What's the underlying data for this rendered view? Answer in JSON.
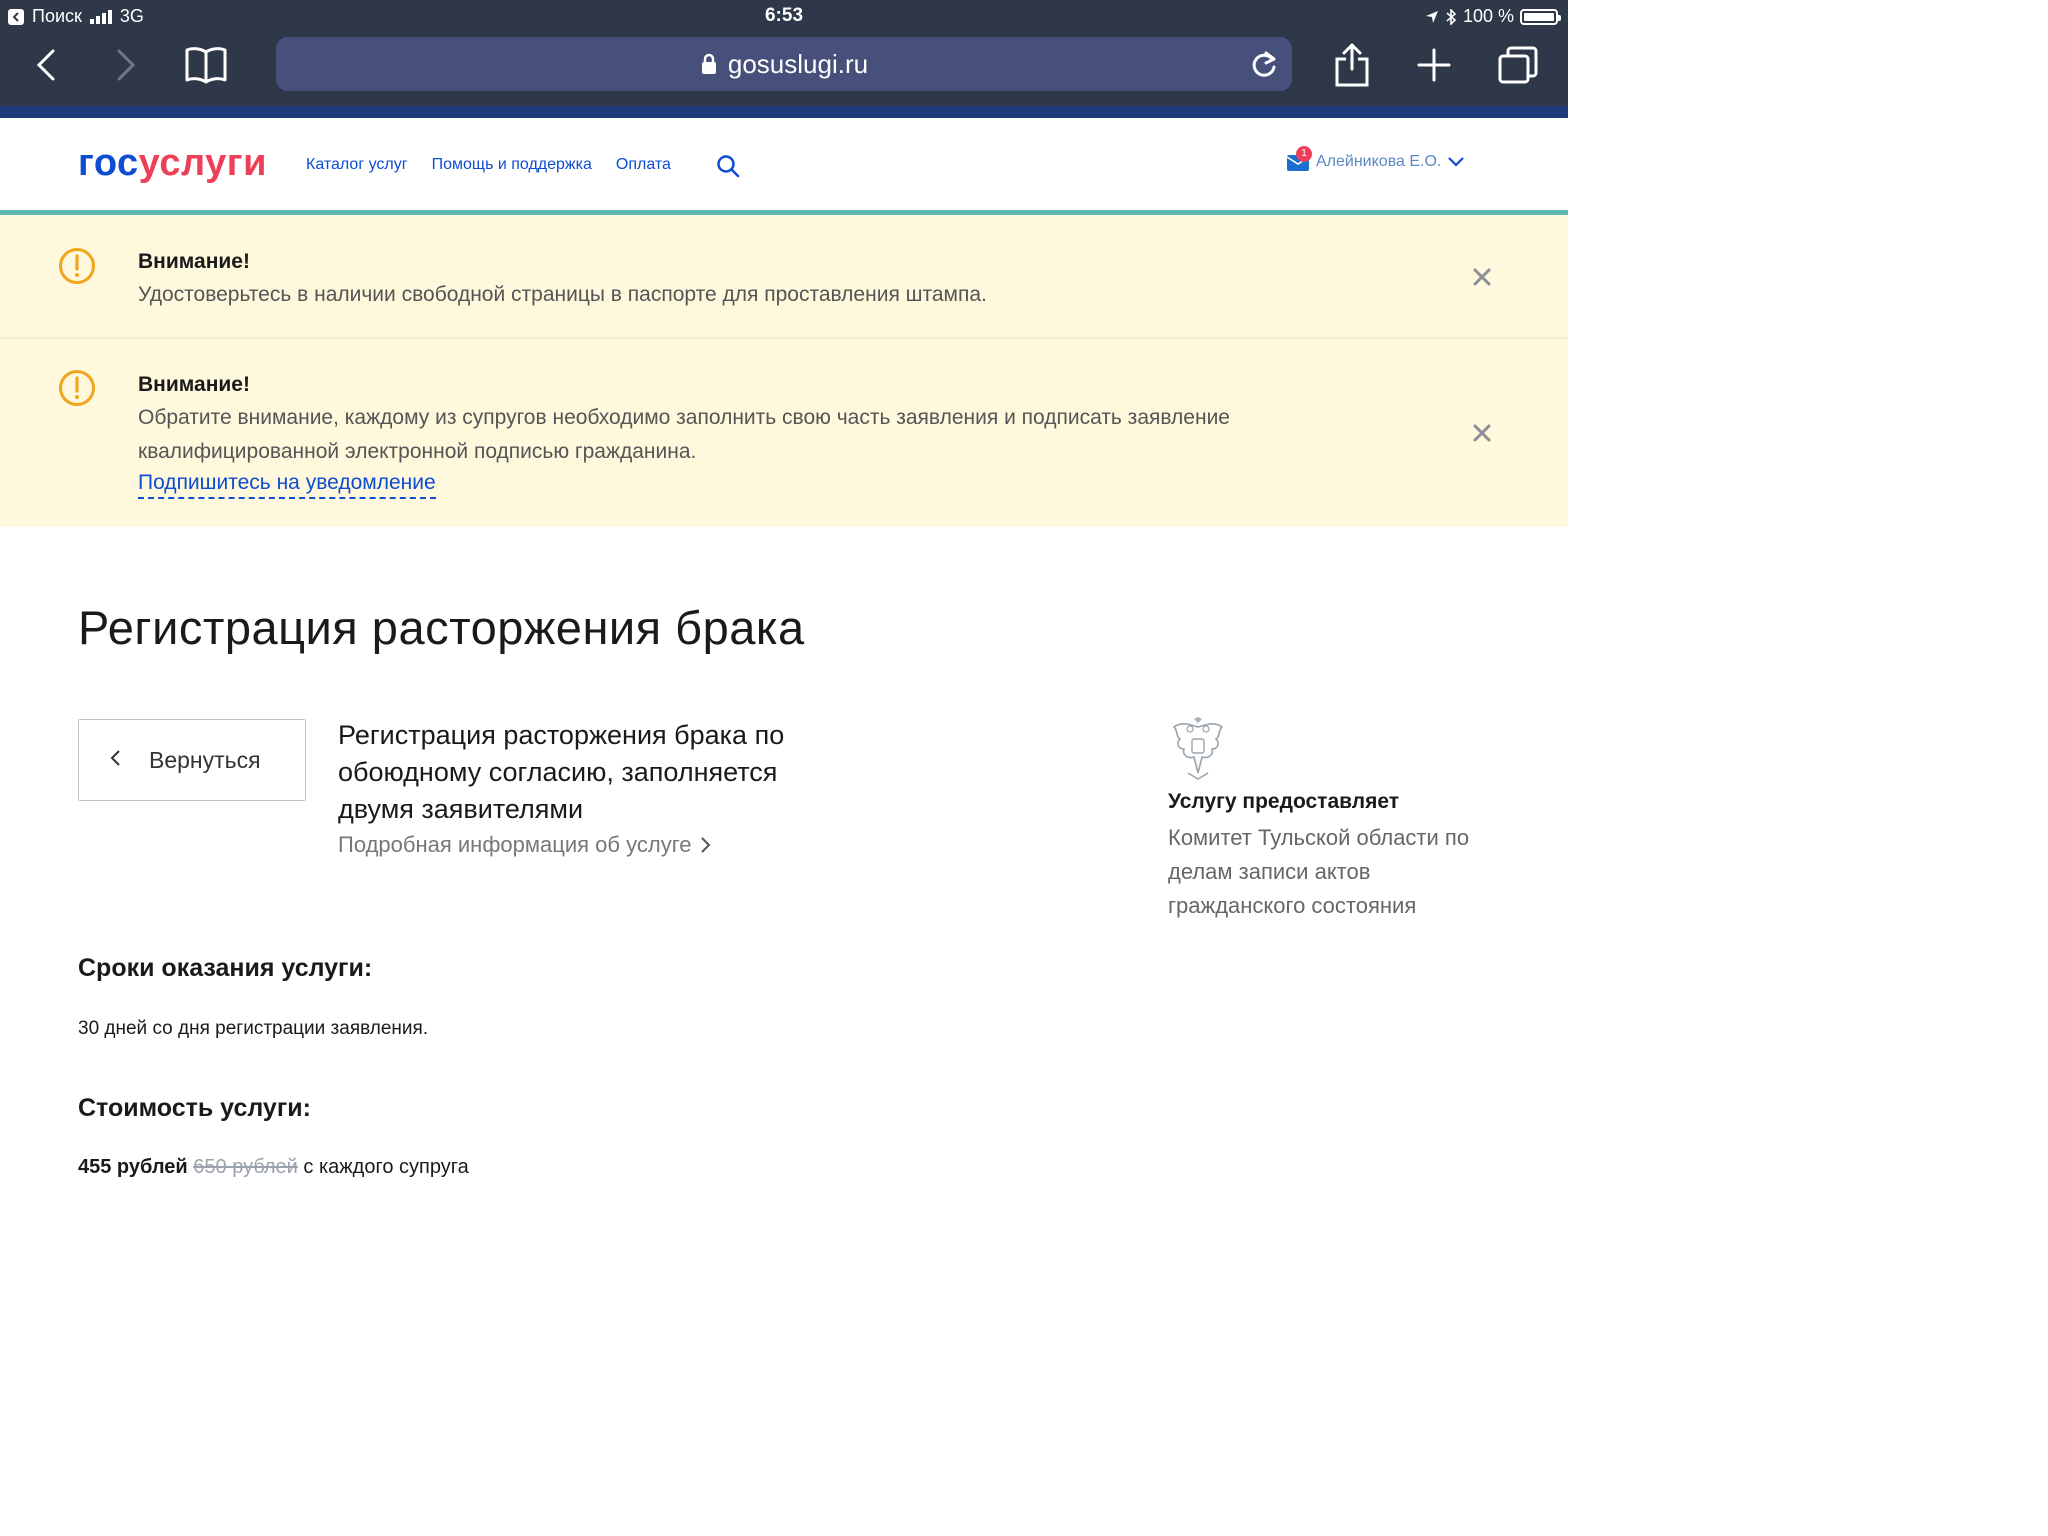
{
  "status_bar": {
    "back_app": "Поиск",
    "network": "3G",
    "time": "6:53",
    "battery": "100 %",
    "battery_level": 1.0
  },
  "browser": {
    "url": "gosuslugi.ru"
  },
  "header": {
    "logo_part1": "гос",
    "logo_part2": "услуги",
    "nav": [
      "Каталог услуг",
      "Помощь и поддержка",
      "Оплата"
    ],
    "notifications_count": "1",
    "user_name": "Алейникова Е.О."
  },
  "alerts": [
    {
      "title": "Внимание!",
      "text": "Удостоверьтесь в наличии свободной страницы в паспорте для проставления штампа."
    },
    {
      "title": "Внимание!",
      "text": "Обратите внимание, каждому из супругов необходимо заполнить свою часть заявления и подписать заявление квалифицированной электронной подписью гражданина.",
      "link": "Подпишитесь на уведомление"
    }
  ],
  "main": {
    "page_title": "Регистрация расторжения брака",
    "back_label": "Вернуться",
    "service_title": "Регистрация расторжения брака по обоюдному согласию, заполняется двумя заявителями",
    "service_more": "Подробная информация об услуге",
    "provider_label": "Услугу предоставляет",
    "provider_name": "Комитет Тульской области по делам записи актов гражданского состояния",
    "terms_heading": "Сроки оказания услуги:",
    "terms_text": "30 дней со дня регистрации заявления.",
    "cost_heading": "Стоимость услуги:",
    "cost_price": "455 рублей",
    "cost_old_price": "650 рублей",
    "cost_suffix": "с каждого супруга"
  },
  "colors": {
    "brand_blue": "#0d4cd3",
    "brand_red": "#ee3f58",
    "alert_bg": "#fef8dd",
    "alert_icon": "#f2a51a",
    "teal_line": "#5fb9b1"
  }
}
